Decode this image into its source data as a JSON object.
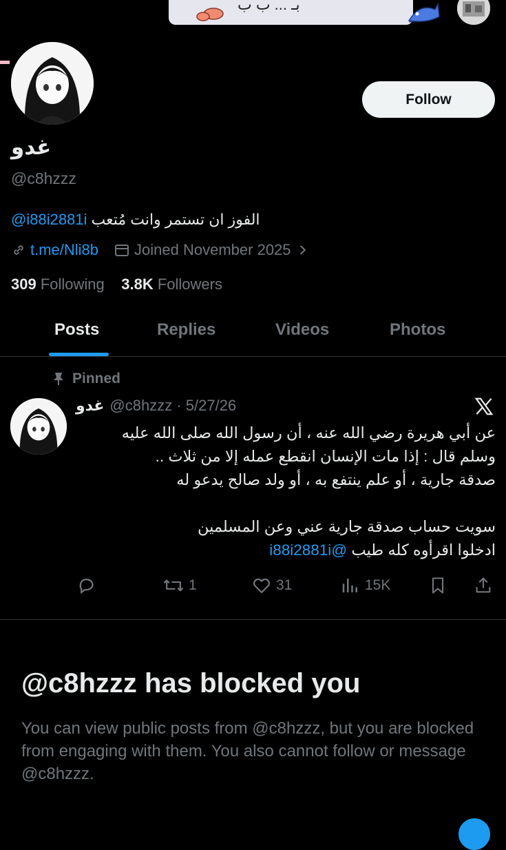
{
  "banner": {
    "text": "بـ ... ب ب"
  },
  "profile": {
    "display_name": "غدو",
    "handle": "@c8hzzz",
    "bio_text": "الفوز ان تستمر وانت مُتعب",
    "bio_mention": "@i88i2881i",
    "link": "t.me/Nli8b",
    "joined": "Joined November 2025",
    "following_count": "309",
    "following_label": "Following",
    "followers_count": "3.8K",
    "followers_label": "Followers",
    "follow_button": "Follow"
  },
  "tabs": [
    "Posts",
    "Replies",
    "Videos",
    "Photos"
  ],
  "pinned_post": {
    "pinned_label": "Pinned",
    "author_name": "غدو",
    "author_handle": "@c8hzzz",
    "date": "5/27/26",
    "lines": [
      "عن أبي هريرة رضي الله عنه ، أن رسول الله صلى الله عليه",
      "وسلم قال : إذا مات الإنسان انقطع عمله إلا من ثلاث ..",
      "صدقة جارية ، أو علم ينتفع به ، أو ولد صالح يدعو له",
      "",
      "سويت حساب صدقة جارية عني وعن المسلمين"
    ],
    "last_line_text": "ادخلوا اقرأوه كله طيب",
    "last_line_mention": "@i88i2881i",
    "replies": "",
    "reposts": "1",
    "likes": "31",
    "views": "15K"
  },
  "blocked": {
    "title": "@c8hzzz has blocked you",
    "description": "You can view public posts from @c8hzzz, but you are blocked from engaging with them. You also cannot follow or message @c8hzzz."
  },
  "colors": {
    "accent": "#1d9bf0",
    "muted": "#71767b",
    "text": "#e7e9ea",
    "background": "#000000"
  }
}
